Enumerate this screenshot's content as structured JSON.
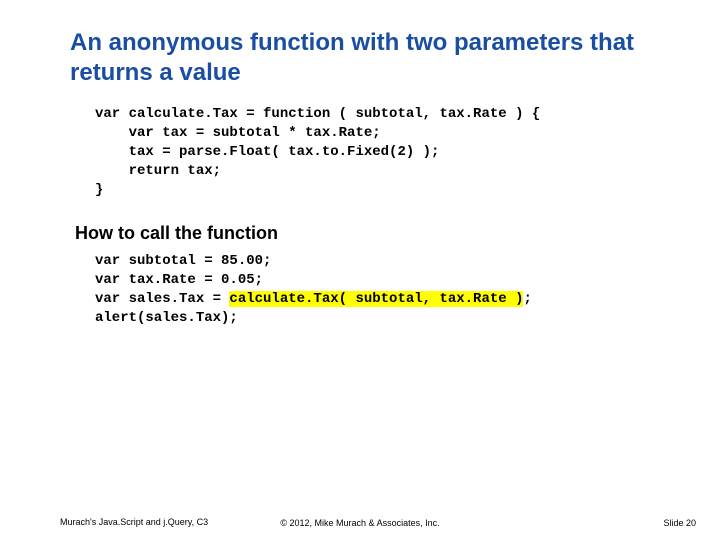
{
  "title": "An anonymous function with two parameters that returns a value",
  "code1": {
    "l1": "var calculate.Tax = function ( subtotal, tax.Rate ) {",
    "l2": "    var tax = subtotal * tax.Rate;",
    "l3": "    tax = parse.Float( tax.to.Fixed(2) );",
    "l4": "    return tax;",
    "l5": "}"
  },
  "subhead": "How to call the function",
  "code2": {
    "l1": "var subtotal = 85.00;",
    "l2": "var tax.Rate = 0.05;",
    "l3a": "var sales.Tax = ",
    "l3b": "calculate.Tax( subtotal, tax.Rate )",
    "l3c": ";",
    "l4": "alert(sales.Tax);"
  },
  "footer": {
    "left": "Murach's Java.Script and j.Query, C3",
    "center": "© 2012, Mike Murach & Associates, Inc.",
    "right": "Slide 20"
  }
}
